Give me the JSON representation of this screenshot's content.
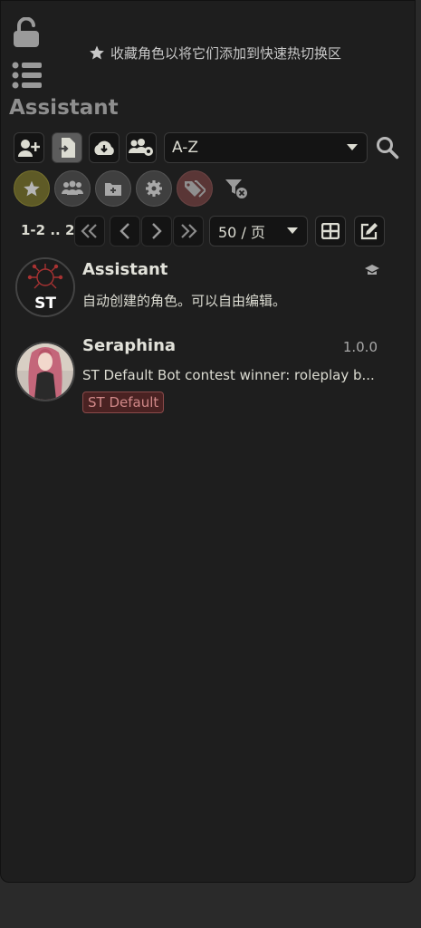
{
  "header": {
    "favorites_hint": "收藏角色以将它们添加到快速热切换区",
    "title": "Assistant"
  },
  "toolbar": {
    "sort_value": "A-Z"
  },
  "pagination": {
    "range": "1-2 .. 2",
    "per_page": "50 / 页"
  },
  "characters": [
    {
      "name": "Assistant",
      "description": "自动创建的角色。可以自由编辑。",
      "avatar_label": "ST",
      "version": ""
    },
    {
      "name": "Seraphina",
      "description": "ST Default Bot contest winner: roleplay b...",
      "version": "1.0.0",
      "tag": "ST Default"
    }
  ],
  "colors": {
    "panel_bg": "#1e1e1e",
    "accent_fav": "#5e5a26",
    "tag_bg": "#4a2222",
    "tag_text": "#d08888"
  }
}
